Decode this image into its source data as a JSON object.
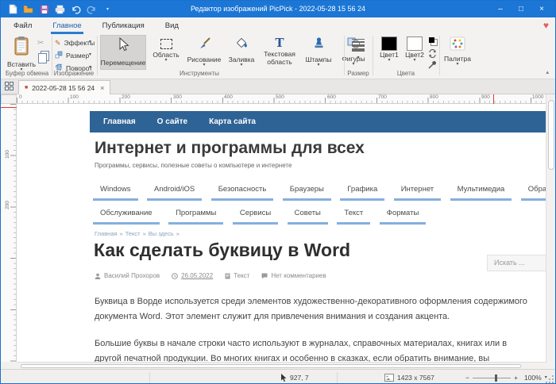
{
  "icons": {
    "chevron_down": "▾",
    "chevron_up": "▴",
    "heart": "♥",
    "scissors": "✂",
    "pencil": "✎",
    "close": "×",
    "minimize": "–",
    "maximize": "□",
    "tab_marker": "■",
    "text_area_glyph": "T",
    "breadcrumb_sep": "»",
    "zoom_minus": "−",
    "zoom_plus": "+"
  },
  "titlebar": {
    "title": "Редактор изображений PicPick - 2022-05-28 15 56 24"
  },
  "menubar": {
    "items": [
      "Файл",
      "Главное",
      "Публикация",
      "Вид"
    ]
  },
  "ribbon": {
    "paste": "Вставить",
    "group_clipboard": "Буфер обмена",
    "effects": "Эффекты",
    "resize": "Размер",
    "rotate": "Поворот",
    "group_image": "Изображение",
    "move": "Перемещение",
    "selection": "Область",
    "draw": "Рисование",
    "fill": "Заливка",
    "text_area_line1": "Текстовая",
    "text_area_line2": "область",
    "stamps": "Штампы",
    "shapes": "Фигуры",
    "group_tools": "Инструменты",
    "group_linesize": "Размер",
    "color1": "Цвет1",
    "color2": "Цвет2",
    "group_colors": "Цвета",
    "palette": "Палитра"
  },
  "tabbar": {
    "tab_title": "2022-05-28 15 56 24"
  },
  "ruler": {
    "h_labels": [
      "0",
      "100",
      "200",
      "300",
      "400",
      "500",
      "600",
      "700",
      "800",
      "900",
      "1000"
    ],
    "v_labels": [
      "100",
      "200"
    ]
  },
  "webpage": {
    "nav": [
      "Главная",
      "О сайте",
      "Карта сайта"
    ],
    "site_title": "Интернет и программы для всех",
    "tagline": "Программы, сервисы, полезные советы о компьютере и интернете",
    "menu_row1": [
      "Windows",
      "Android/iOS",
      "Безопасность",
      "Браузеры",
      "Графика",
      "Интернет",
      "Мультимедиа",
      "Образование"
    ],
    "menu_row2": [
      "Обслуживание",
      "Программы",
      "Сервисы",
      "Советы",
      "Текст",
      "Форматы"
    ],
    "breadcrumb": [
      "Главная",
      "Текст",
      "Вы здесь"
    ],
    "article_title": "Как сделать буквицу в Word",
    "search_placeholder": "Искать ...",
    "meta": {
      "author": "Василий Прохоров",
      "date": "26.05.2022",
      "category": "Текст",
      "comments": "Нет комментариев"
    },
    "paragraph1": "Буквица в Ворде используется среди элементов художественно-декоративного оформления содержимого документа Word. Этот элемент служит для привлечения внимания и создания акцента.",
    "paragraph2": "Большие буквы в начале строки часто используют в журналах, справочных материалах, книгах или в другой печатной продукции. Во многих книгах и особенно в сказках, если обратить внимание, вы"
  },
  "statusbar": {
    "cursor_pos": "927, 7",
    "image_size": "1423 x 7567",
    "zoom": "100%"
  }
}
